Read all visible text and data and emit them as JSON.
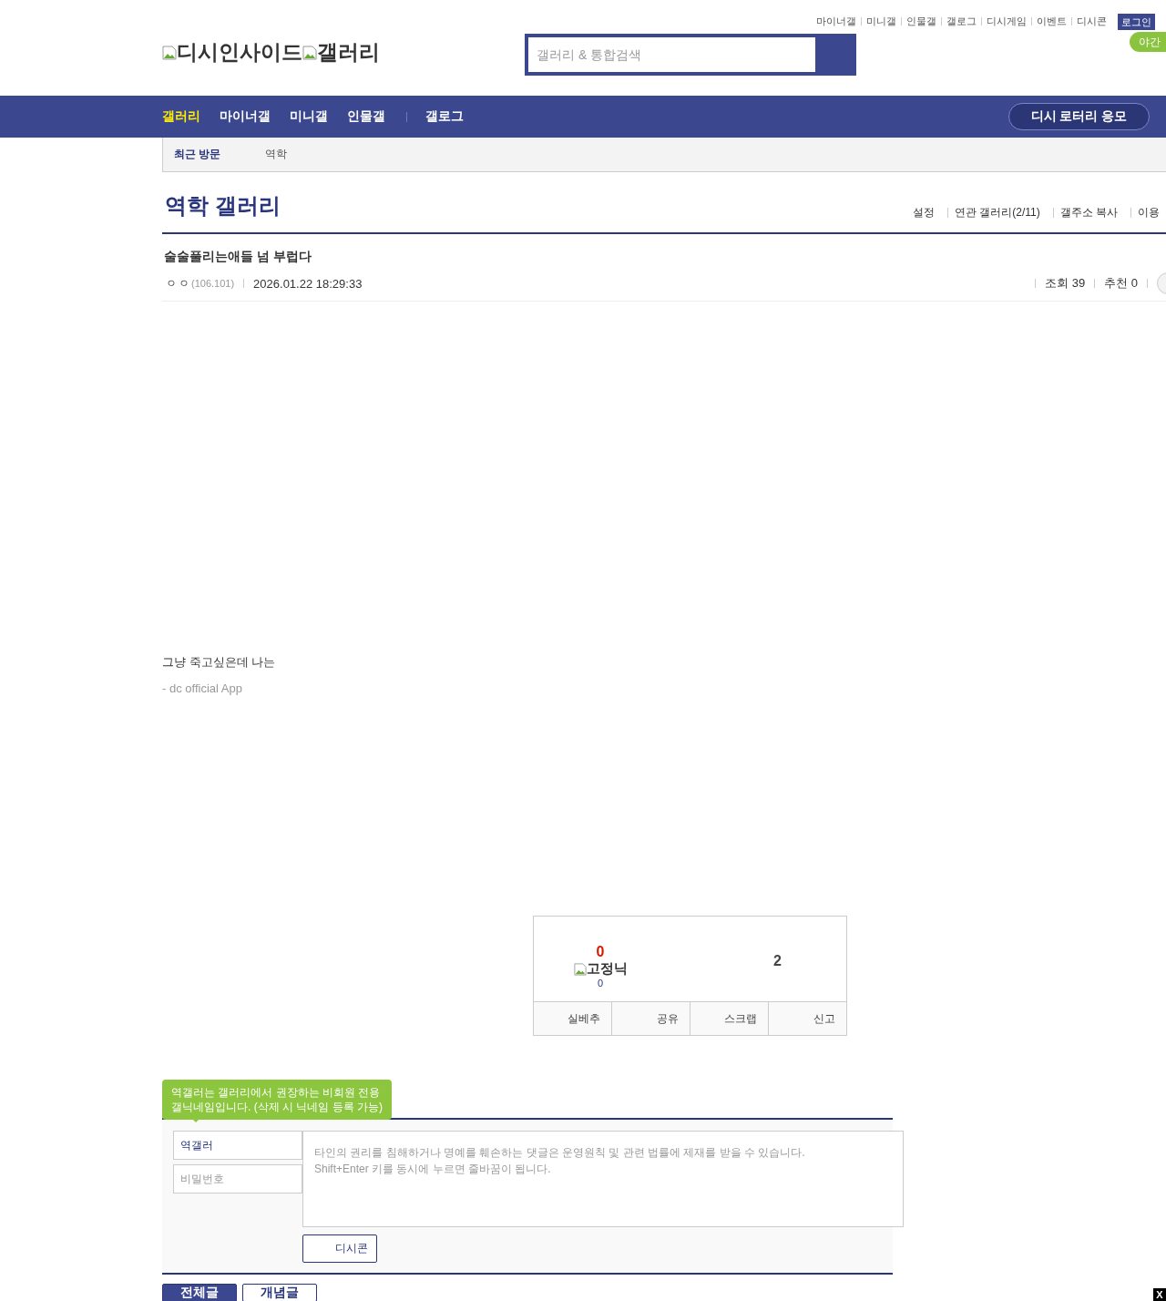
{
  "top_links": [
    "마이너갤",
    "미니갤",
    "인물갤",
    "갤로그",
    "디시게임",
    "이벤트",
    "디시콘"
  ],
  "login_button": "로그인",
  "night_mode_button": "야간",
  "logo": {
    "brand": "디시인사이드",
    "section": "갤러리"
  },
  "search": {
    "placeholder": "갤러리 & 통합검색"
  },
  "nav": [
    {
      "label": "갤러리",
      "selected": true
    },
    {
      "label": "마이너갤",
      "selected": false
    },
    {
      "label": "미니갤",
      "selected": false
    },
    {
      "label": "인물갤",
      "selected": false
    },
    {
      "label": "갤로그",
      "selected": false
    }
  ],
  "lottery_button": "디시 로터리 응모",
  "recent_visits": {
    "label": "최근 방문",
    "items": [
      "역학"
    ]
  },
  "gallery_title": "역학 갤러리",
  "gallery_links": [
    "설정",
    "연관 갤러리(2/11)",
    "갤주소 복사",
    "이용"
  ],
  "post": {
    "title": "술술풀리는애들 넘 부럽다",
    "author": "ㅇㅇ",
    "ip": "(106.101)",
    "date": "2026.01.22 18:29:33",
    "views": "조회 39",
    "recommends": "추천 0",
    "body": [
      "그냥 죽고싶은데 나는"
    ],
    "signature": "- dc official App"
  },
  "vote_box": {
    "up_count": "0",
    "fixed_nick_label": "고정닉",
    "fixed_nick_count": "0",
    "down_count": "2",
    "actions": [
      "실베추",
      "공유",
      "스크랩",
      "신고"
    ]
  },
  "comment_form": {
    "tooltip": "역갤러는 갤러리에서 권장하는 비회원 전용\n갤닉네임입니다. (삭제 시 닉네임 등록 가능)",
    "nickname": "역갤러",
    "password_placeholder": "비밀번호",
    "comment_placeholder": "타인의 권리를 침해하거나 명예를 훼손하는 댓글은 운영원칙 및 관련 법률에 제재를 받을 수 있습니다.\nShift+Enter 키를 동시에 누르면 줄바꿈이 됩니다.",
    "dccon_button": "디시콘"
  },
  "list_tabs": [
    {
      "label": "전체글",
      "selected": true
    },
    {
      "label": "개념글",
      "selected": false
    }
  ],
  "close_button": "X"
}
